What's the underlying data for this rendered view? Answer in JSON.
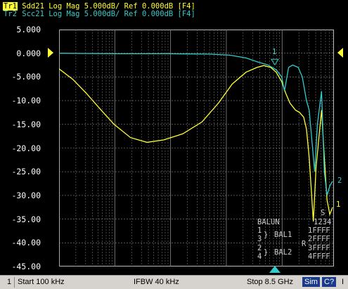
{
  "header": {
    "tr1": {
      "tag": "Tr1",
      "text": " Sdd21 Log Mag 5.000dB/ Ref 0.000dB [F4]"
    },
    "tr2": {
      "tag": "Tr2",
      "text": " Scc21 Log Mag 5.000dB/ Ref 0.000dB [F4]"
    }
  },
  "y_axis": {
    "labels": [
      "5.000",
      "0.000",
      "-5.000",
      "-10.00",
      "-15.00",
      "-20.00",
      "-25.00",
      "-30.00",
      "-35.00",
      "-40.00",
      "-45.00"
    ]
  },
  "markers": {
    "m1_top": "1",
    "m1_trace1_end": "1",
    "m2_trace2_end": "2"
  },
  "balun": {
    "title": "BALUN",
    "lines": [
      "1",
      "3",
      "2",
      "4"
    ],
    "bal1": "BAL1",
    "bal2": "BAL2",
    "s_label": "S",
    "ports_header": "1234",
    "r_label": "R",
    "rows": [
      "1FFFF",
      "2FFFF",
      "3FFFF",
      "4FFFF"
    ]
  },
  "status": {
    "channel": "1",
    "start": "Start 100 kHz",
    "ifbw": "IFBW 40 kHz",
    "stop": "Stop 8.5 GHz",
    "sim": "Sim",
    "c2": "C?",
    "last": "I"
  },
  "colors": {
    "trace1": "#ffff33",
    "trace2": "#33cccc",
    "grid": "#8a8a8a",
    "background": "#000000",
    "status_bg": "#d6d3ce"
  },
  "chart_data": {
    "type": "line",
    "y_unit": "dB",
    "ylim": [
      -45,
      5
    ],
    "y_per_div": 5,
    "x_scale": "log",
    "x_start": "100 kHz",
    "x_stop": "8.5 GHz",
    "grid": true,
    "series": [
      {
        "name": "Sdd21",
        "x_frac": [
          0.0,
          0.05,
          0.1,
          0.15,
          0.2,
          0.26,
          0.32,
          0.38,
          0.45,
          0.52,
          0.58,
          0.63,
          0.68,
          0.72,
          0.745,
          0.77,
          0.79,
          0.81,
          0.825,
          0.84,
          0.86,
          0.875,
          0.89,
          0.9,
          0.91,
          0.925,
          0.935,
          0.945,
          0.955,
          0.965,
          0.975,
          0.985,
          0.995
        ],
        "values": [
          -3.3,
          -5.5,
          -8.5,
          -11.8,
          -15,
          -17.8,
          -18.8,
          -18.3,
          -17,
          -14.5,
          -10.5,
          -6.5,
          -4,
          -3,
          -2.6,
          -3,
          -4,
          -6,
          -8.5,
          -10.5,
          -12,
          -12.5,
          -13.5,
          -16,
          -22,
          -35.5,
          -24,
          -18,
          -12,
          -22,
          -31,
          -34,
          -32.5
        ]
      },
      {
        "name": "Scc21",
        "x_frac": [
          0.0,
          0.2,
          0.4,
          0.55,
          0.62,
          0.68,
          0.72,
          0.76,
          0.79,
          0.81,
          0.82,
          0.835,
          0.85,
          0.87,
          0.885,
          0.9,
          0.91,
          0.93,
          0.94,
          0.955,
          0.965,
          0.975,
          0.985,
          0.995
        ],
        "values": [
          0,
          -0.1,
          -0.1,
          -0.2,
          -0.4,
          -1,
          -1.8,
          -2.5,
          -3.5,
          -5,
          -8,
          -3,
          -2.5,
          -3,
          -5,
          -10,
          -12,
          -25,
          -15,
          -8,
          -25,
          -30,
          -28,
          -27
        ]
      }
    ]
  }
}
